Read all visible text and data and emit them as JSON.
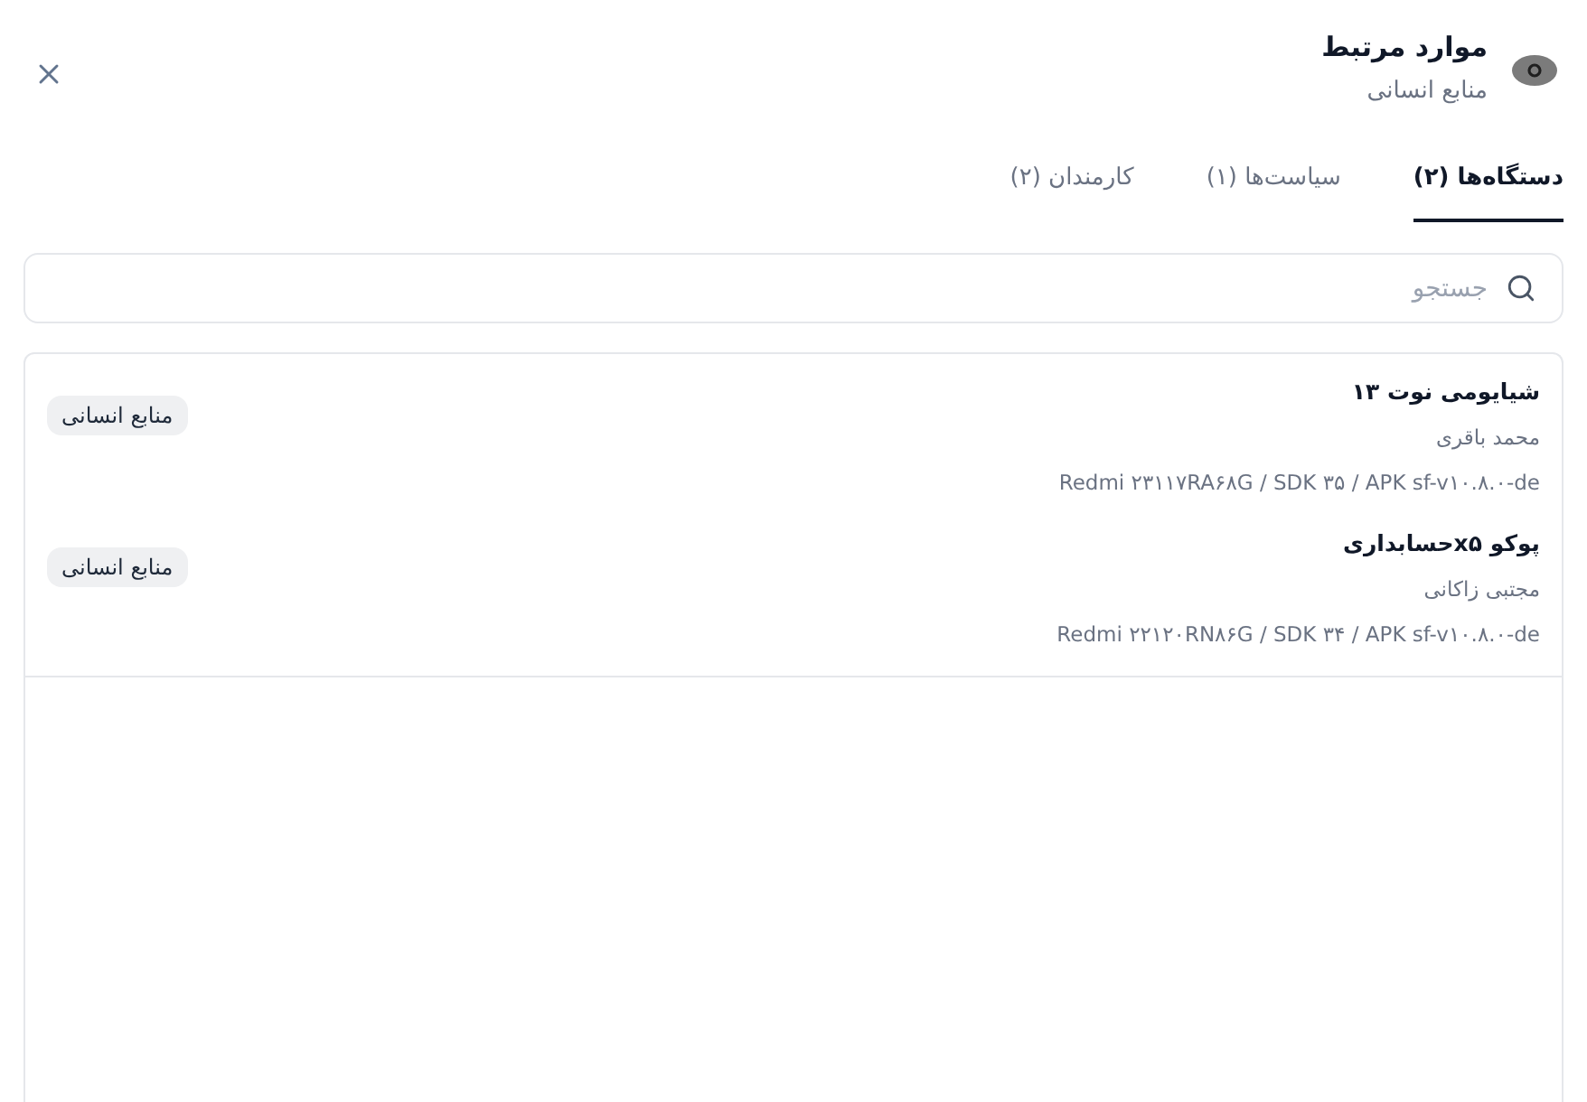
{
  "header": {
    "title": "موارد مرتبط",
    "subtitle": "منابع انسانی"
  },
  "tabs": [
    {
      "label": "دستگاه‌ها (۲)",
      "selected": true
    },
    {
      "label": "سیاست‌ها (۱)",
      "selected": false
    },
    {
      "label": "کارمندان (۲)",
      "selected": false
    }
  ],
  "search": {
    "placeholder": "جستجو"
  },
  "devices": [
    {
      "name": "شیایومی نوت ۱۳",
      "owner": "محمد باقری",
      "details": "Redmi ۲۳۱۱۷RA۶۸G / SDK ۳۵ / APK sf-v۱۰.۸.۰-de",
      "tag": "منابع انسانی"
    },
    {
      "name": "پوکو x۵حسابداری",
      "owner": "مجتبی زاکانی",
      "details": "Redmi ۲۲۱۲۰RN۸۶G / SDK ۳۴ / APK sf-v۱۰.۸.۰-de",
      "tag": "منابع انسانی"
    }
  ]
}
